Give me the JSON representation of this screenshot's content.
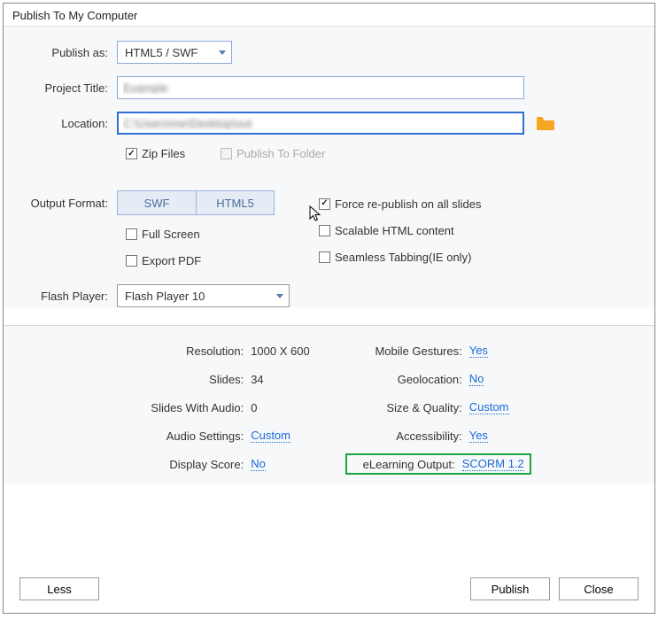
{
  "dialog": {
    "title": "Publish To My Computer"
  },
  "publish_as": {
    "label": "Publish as:",
    "value": "HTML5 / SWF"
  },
  "project_title": {
    "label": "Project Title:",
    "value": "Example"
  },
  "location": {
    "label": "Location:",
    "value": "C:\\Users\\me\\Desktop\\out"
  },
  "zip_files": {
    "label": "Zip Files",
    "checked": true
  },
  "publish_to_folder": {
    "label": "Publish To Folder",
    "checked": false,
    "disabled": true
  },
  "output_format": {
    "label": "Output Format:",
    "swf": "SWF",
    "html5": "HTML5",
    "full_screen": "Full Screen",
    "export_pdf": "Export PDF",
    "force_republish": "Force re-publish on all slides",
    "scalable_html": "Scalable HTML content",
    "seamless_tabbing": "Seamless Tabbing(IE only)"
  },
  "flash_player": {
    "label": "Flash Player:",
    "value": "Flash Player 10"
  },
  "info": {
    "resolution": {
      "label": "Resolution:",
      "value": "1000 X 600"
    },
    "slides": {
      "label": "Slides:",
      "value": "34"
    },
    "slides_audio": {
      "label": "Slides With Audio:",
      "value": "0"
    },
    "audio_settings": {
      "label": "Audio Settings:",
      "value": "Custom"
    },
    "display_score": {
      "label": "Display Score:",
      "value": "No"
    },
    "mobile_gestures": {
      "label": "Mobile Gestures:",
      "value": "Yes"
    },
    "geolocation": {
      "label": "Geolocation:",
      "value": "No"
    },
    "size_quality": {
      "label": "Size & Quality:",
      "value": "Custom"
    },
    "accessibility": {
      "label": "Accessibility:",
      "value": "Yes"
    },
    "elearning": {
      "label": "eLearning Output:",
      "value": "SCORM 1.2"
    }
  },
  "buttons": {
    "less": "Less",
    "publish": "Publish",
    "close": "Close"
  }
}
